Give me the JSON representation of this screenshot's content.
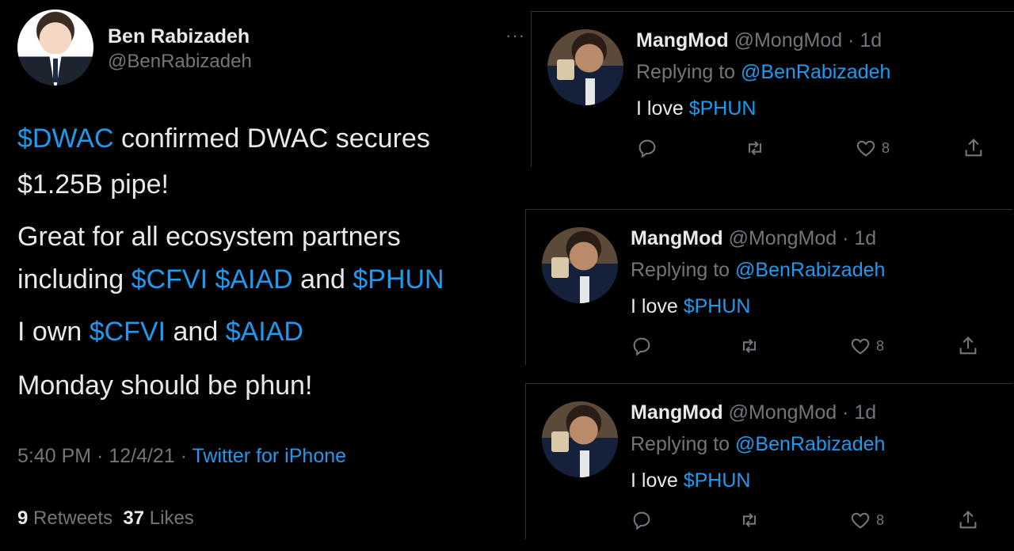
{
  "main_tweet": {
    "author_name": "Ben Rabizadeh",
    "author_handle": "@BenRabizadeh",
    "more": "···",
    "line1": {
      "cashtag": "$DWAC",
      "text": " confirmed DWAC secures"
    },
    "line2": {
      "text": "$1.25B pipe!"
    },
    "line3": {
      "text": "Great for all ecosystem partners"
    },
    "line4": {
      "pre": "including ",
      "tag1": "$CFVI",
      "sp1": " ",
      "tag2": "$AIAD",
      "mid": " and ",
      "tag3": "$PHUN"
    },
    "line5": {
      "pre": "I own ",
      "tag1": "$CFVI",
      "mid": " and ",
      "tag2": "$AIAD"
    },
    "line6": {
      "text": "Monday should be phun!"
    },
    "time": "5:40 PM · 12/4/21 · ",
    "source": "Twitter for iPhone",
    "retweets_count": "9",
    "retweets_label": " Retweets  ",
    "likes_count": "37",
    "likes_label": " Likes"
  },
  "replies": [
    {
      "name": "MangMod",
      "handle_time": " @MongMod · 1d",
      "replying_label": "Replying to ",
      "replying_handle": "@BenRabizadeh",
      "text_pre": "I love ",
      "text_tag": "$PHUN",
      "like_count": "8"
    },
    {
      "name": "MangMod",
      "handle_time": " @MongMod · 1d",
      "replying_label": "Replying to ",
      "replying_handle": "@BenRabizadeh",
      "text_pre": "I love ",
      "text_tag": "$PHUN",
      "like_count": "8"
    },
    {
      "name": "MangMod",
      "handle_time": " @MongMod · 1d",
      "replying_label": "Replying to ",
      "replying_handle": "@BenRabizadeh",
      "text_pre": "I love ",
      "text_tag": "$PHUN",
      "like_count": "8"
    }
  ],
  "icons": {
    "reply": "reply-icon",
    "retweet": "retweet-icon",
    "like": "heart-icon",
    "share": "share-icon"
  },
  "colors": {
    "background": "#000000",
    "text": "#e7e9ea",
    "muted": "#71767b",
    "link": "#1d9bf0"
  }
}
